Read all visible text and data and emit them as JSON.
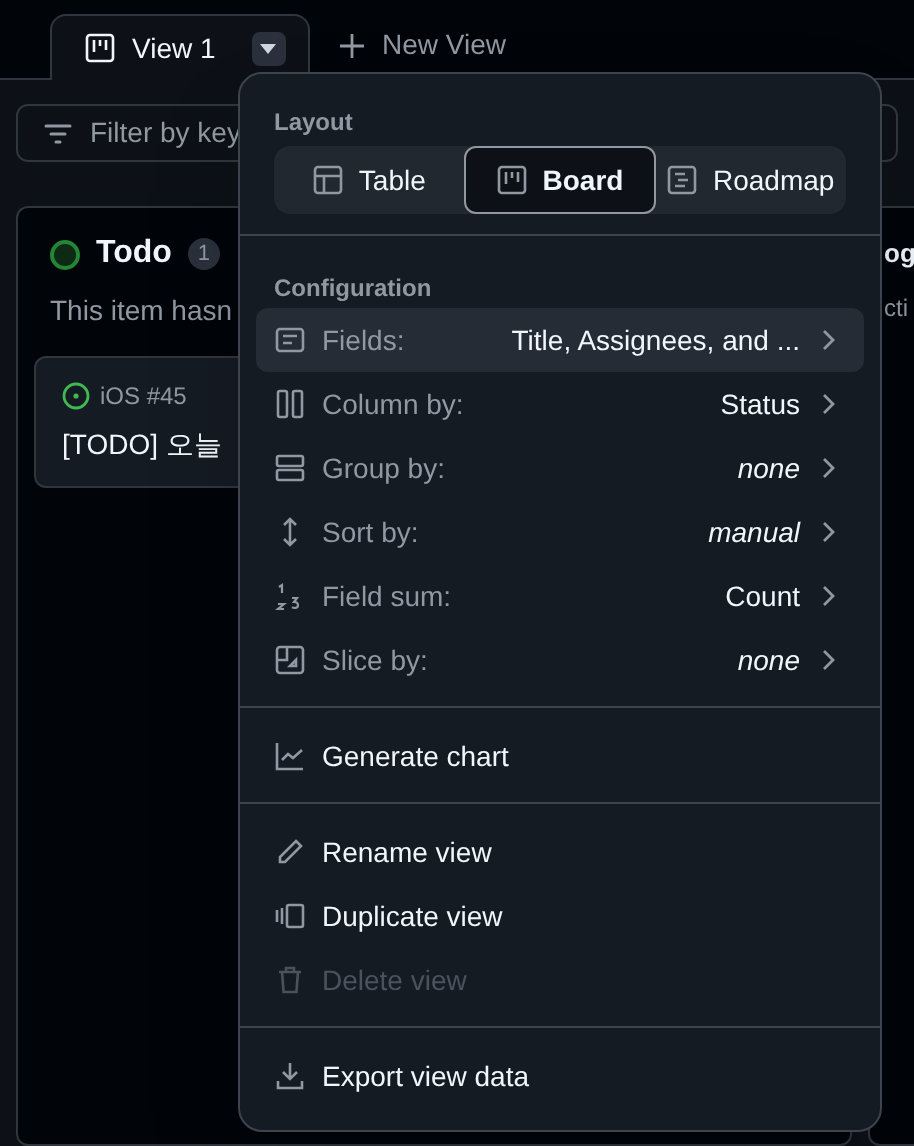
{
  "tabs": [
    {
      "label": "View 1",
      "selected": true
    }
  ],
  "new_view": {
    "label": "New View"
  },
  "filter": {
    "placeholder": "Filter by key"
  },
  "columns": [
    {
      "title": "Todo",
      "count": "1",
      "description": "This item hasn",
      "cards": [
        {
          "ref": "iOS #45",
          "title": "[TODO] 오늘"
        }
      ]
    },
    {
      "title": "og",
      "description": "cti"
    }
  ],
  "menu": {
    "layout_heading": "Layout",
    "layouts": [
      {
        "label": "Table",
        "selected": false
      },
      {
        "label": "Board",
        "selected": true
      },
      {
        "label": "Roadmap",
        "selected": false
      }
    ],
    "config_heading": "Configuration",
    "config": [
      {
        "label": "Fields:",
        "value": "Title, Assignees, and ...",
        "italic": false,
        "selected": true
      },
      {
        "label": "Column by:",
        "value": "Status",
        "italic": false,
        "selected": false
      },
      {
        "label": "Group by:",
        "value": "none",
        "italic": true,
        "selected": false
      },
      {
        "label": "Sort by:",
        "value": "manual",
        "italic": true,
        "selected": false
      },
      {
        "label": "Field sum:",
        "value": "Count",
        "italic": false,
        "selected": false
      },
      {
        "label": "Slice by:",
        "value": "none",
        "italic": true,
        "selected": false
      }
    ],
    "groups": [
      [
        {
          "label": "Generate chart",
          "disabled": false
        }
      ],
      [
        {
          "label": "Rename view",
          "disabled": false
        },
        {
          "label": "Duplicate view",
          "disabled": false
        },
        {
          "label": "Delete view",
          "disabled": true
        }
      ],
      [
        {
          "label": "Export view data",
          "disabled": false
        }
      ]
    ]
  }
}
